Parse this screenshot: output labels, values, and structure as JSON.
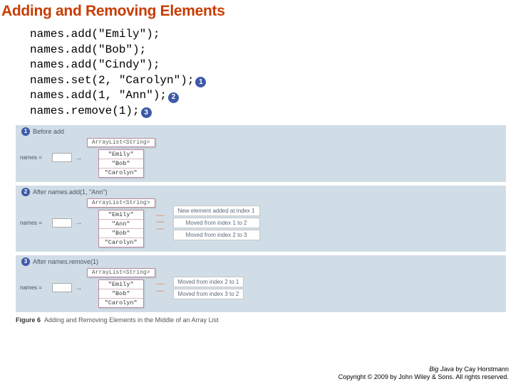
{
  "title": "Adding and Removing Elements",
  "code": {
    "l1": "names.add(\"Emily\");",
    "l2": "names.add(\"Bob\");",
    "l3": "names.add(\"Cindy\");",
    "l4": "names.set(2, \"Carolyn\");",
    "l5": "names.add(1, \"Ann\");",
    "l6": "names.remove(1);"
  },
  "callouts": {
    "c1": "1",
    "c2": "2",
    "c3": "3"
  },
  "panels": {
    "p1": {
      "label": "Before add",
      "var": "names =",
      "type": "ArrayList<String>",
      "cells": [
        "\"Emily\"",
        "\"Bob\"",
        "\"Carolyn\""
      ]
    },
    "p2": {
      "label": "After names.add(1, \"Ann\")",
      "var": "names =",
      "type": "ArrayList<String>",
      "cells": [
        "\"Emily\"",
        "\"Ann\"",
        "\"Bob\"",
        "\"Carolyn\""
      ],
      "notes": [
        "New element added at index 1",
        "Moved from index 1 to 2",
        "Moved from index 2 to 3"
      ]
    },
    "p3": {
      "label": "After names.remove(1)",
      "var": "names =",
      "type": "ArrayList<String>",
      "cells": [
        "\"Emily\"",
        "\"Bob\"",
        "\"Carolyn\""
      ],
      "notes": [
        "Moved from index 2 to 1",
        "Moved from index 3 to 2"
      ]
    }
  },
  "caption": {
    "fig": "Figure 6",
    "text": "Adding and Removing Elements in the Middle of an Array List"
  },
  "footer": {
    "line1a": "Big Java",
    "line1b": " by Cay Horstmann",
    "line2": "Copyright © 2009 by John Wiley & Sons.  All rights reserved."
  }
}
